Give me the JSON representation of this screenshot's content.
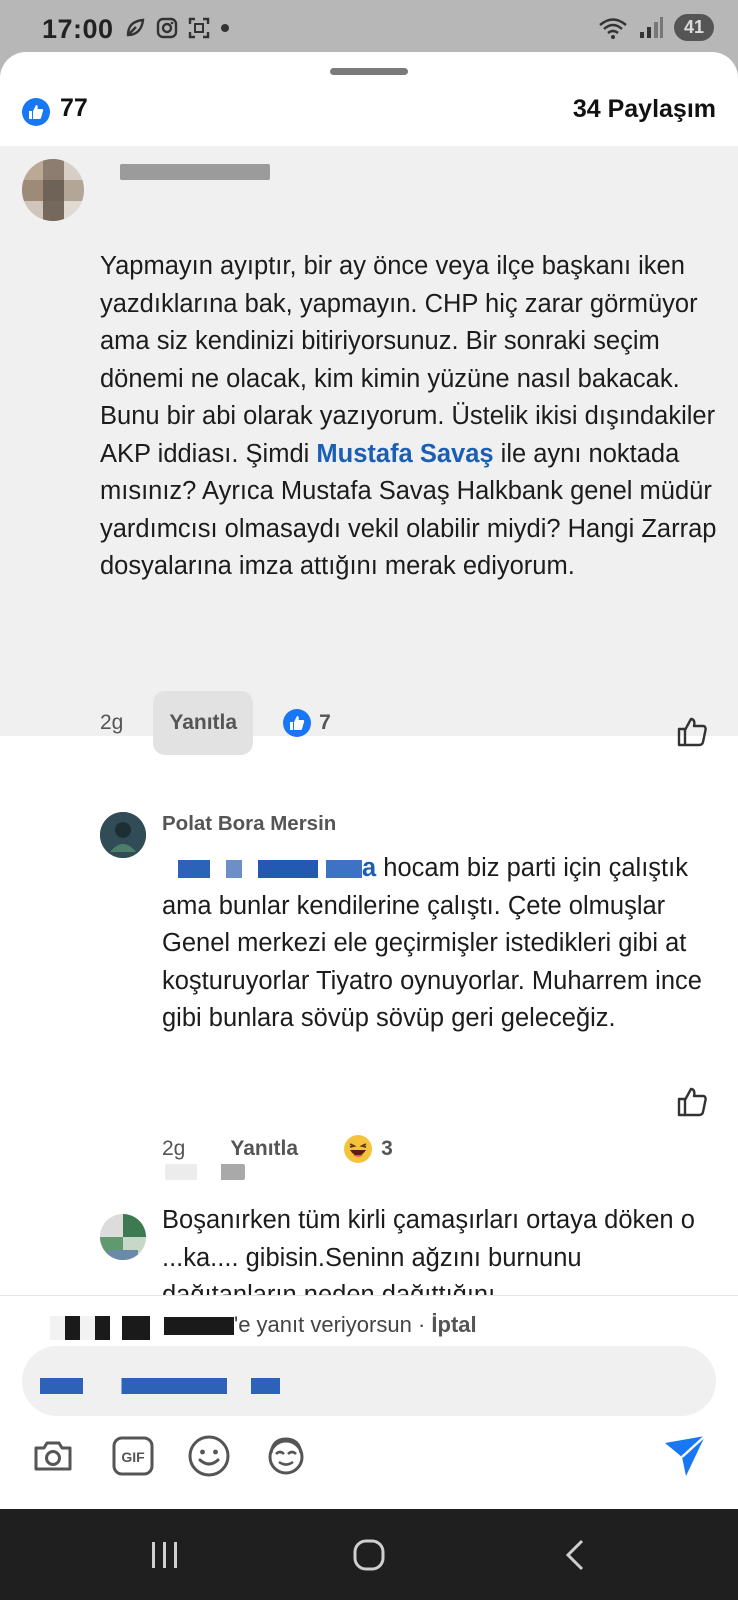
{
  "status": {
    "time": "17:00",
    "battery": "41"
  },
  "header": {
    "like_count": "77",
    "share_label": "34 Paylaşım"
  },
  "comments": [
    {
      "text_before": "Yapmayın ayıptır, bir ay önce veya ilçe başkanı iken yazdıklarına bak, yapmayın. CHP hiç zarar görmüyor ama siz kendinizi bitiriyorsunuz. Bir sonraki seçim dönemi ne olacak, kim kimin yüzüne nasıl bakacak. Bunu bir abi olarak yazıyorum. Üstelik ikisi dışındakiler AKP iddiası. Şimdi ",
      "mention": "Mustafa Savaş",
      "text_after": " ile aynı noktada mısınız? Ayrıca Mustafa Savaş  Halkbank genel müdür yardımcısı olmasaydı vekil olabilir miydi? Hangi Zarrap dosyalarına imza attığını merak ediyorum.",
      "time": "2g",
      "reply_label": "Yanıtla",
      "reaction_count": "7"
    },
    {
      "author": "Polat Bora Mersin",
      "text": " hocam biz parti için çalıştık ama bunlar kendilerine çalıştı. Çete olmuşlar Genel merkezi ele geçirmişler istedikleri gibi at koşturuyorlar Tiyatro oynuyorlar. Muharrem ince gibi bunlara sövüp sövüp geri geleceğiz.",
      "mention_tail": "a",
      "time": "2g",
      "reply_label": "Yanıtla",
      "reaction_count": "3"
    },
    {
      "text": "Boşanırken tüm kirli çamaşırları ortaya döken o ...ka.... gibisin.Seninn ağzını burnunu dağıtanların neden dağıttığını"
    }
  ],
  "reply_bar": {
    "name_tail": "'e yanıt veriyorsun",
    "separator": " · ",
    "cancel": "İptal"
  },
  "toolbar": [
    "camera-icon",
    "gif-icon",
    "emoji-icon",
    "avatar-sticker-icon",
    "send-icon"
  ],
  "colors": {
    "facebook_blue": "#1877f2",
    "mention_blue": "#1b5fb4"
  }
}
